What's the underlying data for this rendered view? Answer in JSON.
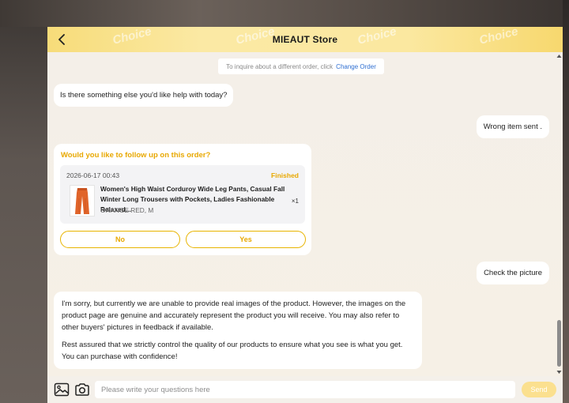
{
  "header": {
    "title": "MIEAUT Store",
    "watermark": "Choice"
  },
  "notice": {
    "text": "To inquire about a different order, click",
    "link": "Change Order"
  },
  "messages": {
    "agent_help": "Is there something else you'd like help with today?",
    "user_wrong_item": "Wrong item sent .",
    "user_check_picture": "Check the picture",
    "agent_reply_p1": "I'm sorry, but currently we are unable to provide real images of the product. However, the images on the product page are genuine and accurately represent the product you will receive. You may also refer to other buyers' pictures in feedback if available.",
    "agent_reply_p2": "Rest assured that we strictly control the quality of our products to ensure what you see is what you get. You can purchase with confidence!"
  },
  "follow_up": {
    "title": "Would you like to follow up on this order?",
    "order": {
      "date": "2026-06-17 00:43",
      "status": "Finished",
      "product_title": "Women's High Waist Corduroy Wide Leg Pants, Casual Fall Winter Long Trousers with Pockets, Ladies Fashionable Relaxed...",
      "quantity": "×1",
      "variant": "ORANGE RED, M"
    },
    "no_label": "No",
    "yes_label": "Yes"
  },
  "composer": {
    "placeholder": "Please write your questions here",
    "send_label": "Send"
  },
  "colors": {
    "accent": "#e8a800",
    "header_gradient_start": "#f7dc79",
    "link": "#2f6fd1",
    "send_disabled": "#fbe08f",
    "product": "#e0642a"
  },
  "icons": {
    "back": "chevron-left-icon",
    "image": "image-icon",
    "camera": "camera-icon"
  }
}
